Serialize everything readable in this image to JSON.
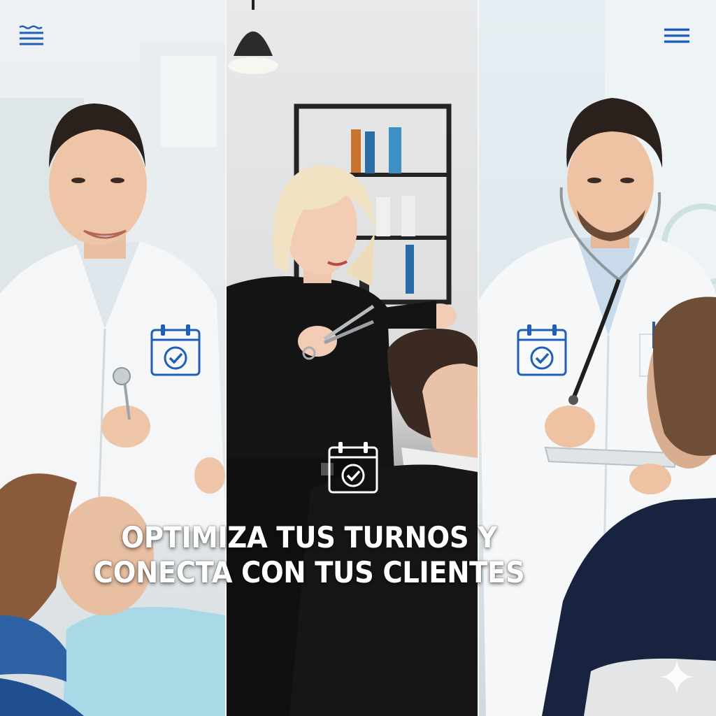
{
  "headline": {
    "line1": "OPTIMIZA TUS TURNOS Y",
    "line2": "CONECTA CON TUS CLIENTES"
  },
  "panels": [
    {
      "scene": "dentist-with-patient"
    },
    {
      "scene": "hair-stylist-with-client"
    },
    {
      "scene": "doctor-with-patient"
    }
  ],
  "icons": {
    "top_left": "menu-wave-icon",
    "top_right": "hamburger-menu-icon",
    "calendar": "calendar-check-icon",
    "corner": "sparkle-icon"
  },
  "colors": {
    "accent_blue": "#1f5fb8",
    "headline_text": "#ffffff"
  }
}
